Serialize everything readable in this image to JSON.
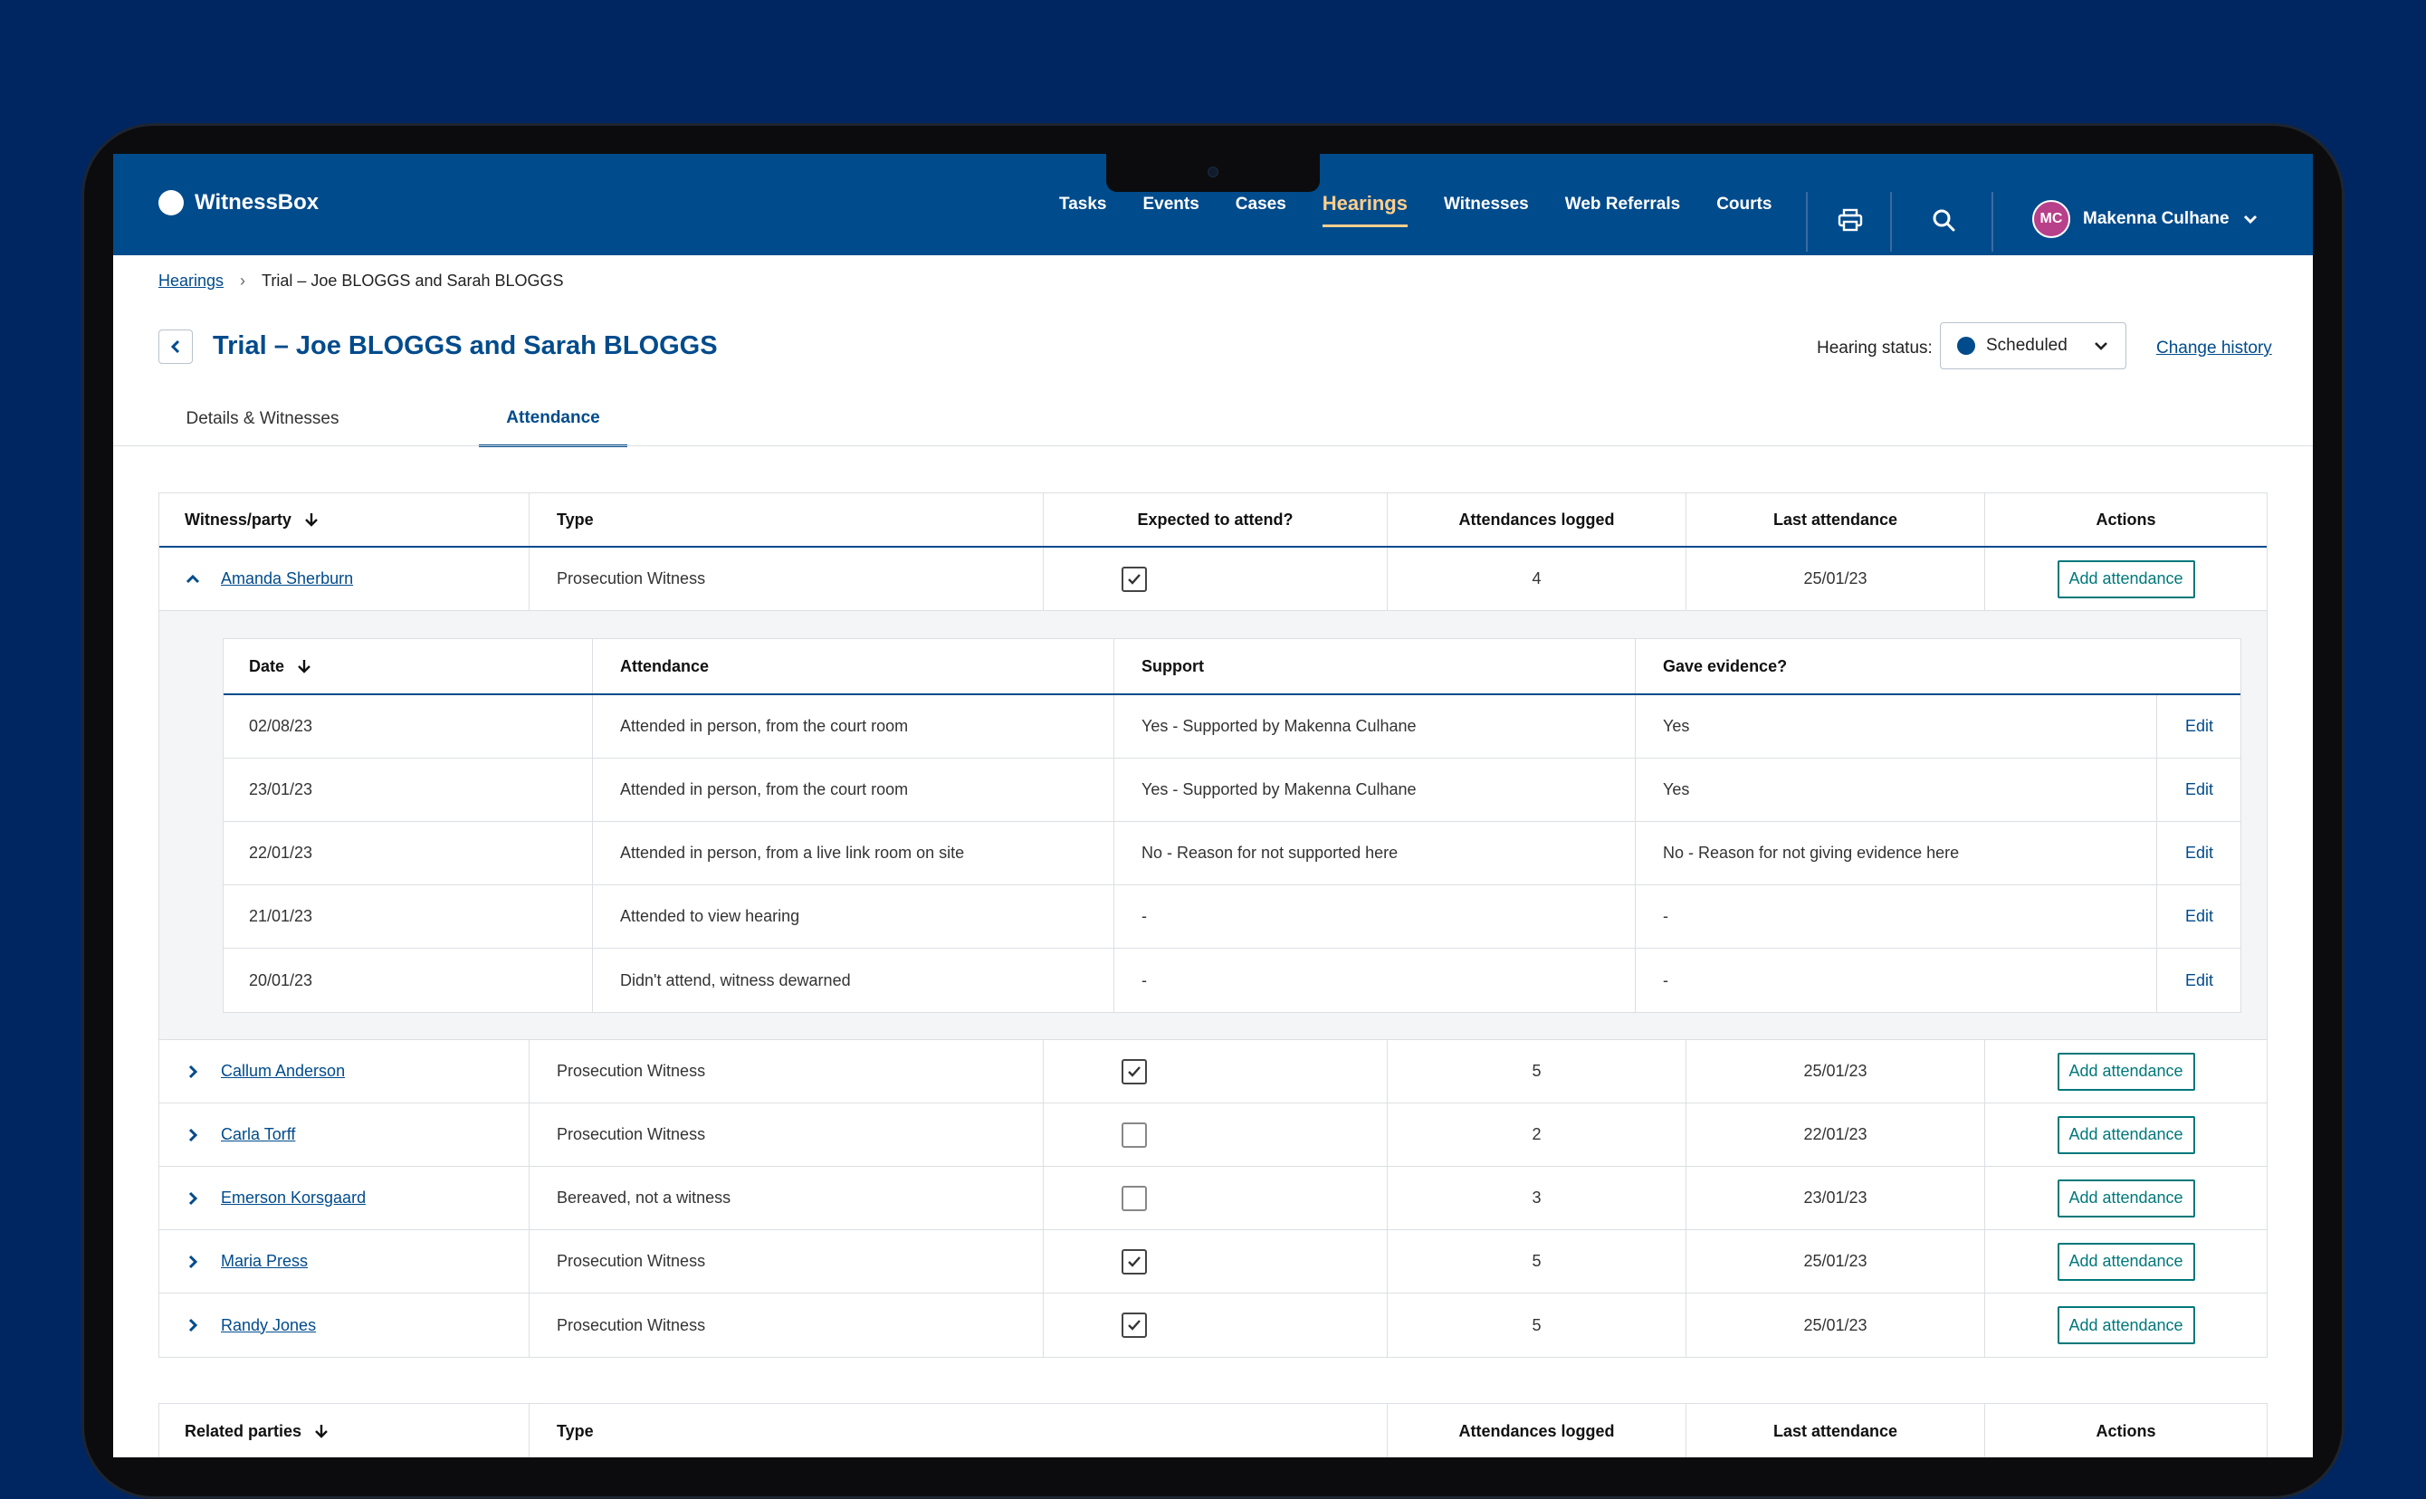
{
  "app": {
    "name": "WitnessBox"
  },
  "nav": {
    "items": [
      "Tasks",
      "Events",
      "Cases",
      "Hearings",
      "Witnesses",
      "Web Referrals",
      "Courts"
    ],
    "active": "Hearings"
  },
  "user": {
    "initials": "MC",
    "name": "Makenna Culhane"
  },
  "breadcrumb": {
    "root": "Hearings",
    "current": "Trial – Joe BLOGGS and Sarah BLOGGS"
  },
  "page": {
    "title": "Trial – Joe BLOGGS and Sarah BLOGGS"
  },
  "hearing_status": {
    "label": "Hearing status:",
    "value": "Scheduled"
  },
  "change_history": "Change history",
  "tabs": [
    "Details & Witnesses",
    "Attendance"
  ],
  "witness_table": {
    "headers": [
      "Witness/party",
      "Type",
      "Expected to attend?",
      "Attendances logged",
      "Last attendance",
      "Actions"
    ],
    "action_label": "Add attendance",
    "rows": [
      {
        "name": "Amanda Sherburn",
        "type": "Prosecution Witness",
        "expected": true,
        "logged": "4",
        "last": "25/01/23",
        "expanded": true
      },
      {
        "name": "Callum Anderson",
        "type": "Prosecution Witness",
        "expected": true,
        "logged": "5",
        "last": "25/01/23"
      },
      {
        "name": "Carla Torff",
        "type": "Prosecution Witness",
        "expected": false,
        "logged": "2",
        "last": "22/01/23"
      },
      {
        "name": "Emerson Korsgaard",
        "type": "Bereaved, not a witness",
        "expected": false,
        "logged": "3",
        "last": "23/01/23"
      },
      {
        "name": "Maria Press",
        "type": "Prosecution Witness",
        "expected": true,
        "logged": "5",
        "last": "25/01/23"
      },
      {
        "name": "Randy Jones",
        "type": "Prosecution Witness",
        "expected": true,
        "logged": "5",
        "last": "25/01/23"
      }
    ]
  },
  "attendance_subtable": {
    "headers": [
      "Date",
      "Attendance",
      "Support",
      "Gave evidence?"
    ],
    "edit_label": "Edit",
    "rows": [
      {
        "date": "02/08/23",
        "attendance": "Attended in person, from the court room",
        "support": "Yes - Supported by Makenna Culhane",
        "evidence": "Yes"
      },
      {
        "date": "23/01/23",
        "attendance": "Attended in person, from the court room",
        "support": "Yes - Supported by Makenna Culhane",
        "evidence": "Yes"
      },
      {
        "date": "22/01/23",
        "attendance": "Attended in person, from a live link room on site",
        "support": "No - Reason for not supported here",
        "evidence": "No - Reason for not giving evidence here"
      },
      {
        "date": "21/01/23",
        "attendance": "Attended to view hearing",
        "support": "-",
        "evidence": "-"
      },
      {
        "date": "20/01/23",
        "attendance": "Didn't attend, witness dewarned",
        "support": "-",
        "evidence": "-"
      }
    ]
  },
  "related_table": {
    "headers": [
      "Related parties",
      "Type",
      "Attendances logged",
      "Last attendance",
      "Actions"
    ]
  }
}
